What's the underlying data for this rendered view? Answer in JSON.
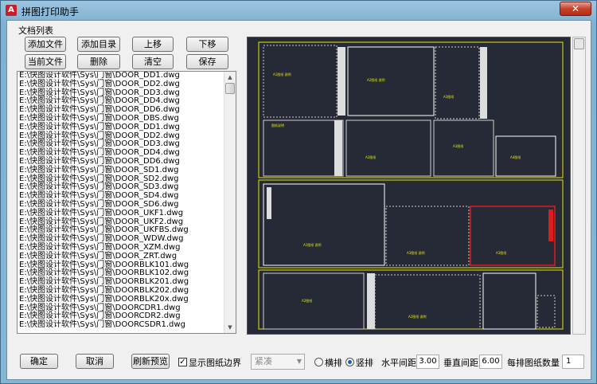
{
  "window": {
    "title": "拼图打印助手",
    "app_icon": "A",
    "close": "✕"
  },
  "file_group": {
    "label": "文档列表"
  },
  "toolbar": {
    "add_file": "添加文件",
    "add_dir": "添加目录",
    "move_up": "上移",
    "move_down": "下移",
    "current_file": "当前文件",
    "delete": "删除",
    "clear": "清空",
    "save": "保存"
  },
  "files": [
    "E:\\快图设计软件\\Sys\\门窗\\DOOR_DD1.dwg",
    "E:\\快图设计软件\\Sys\\门窗\\DOOR_DD2.dwg",
    "E:\\快图设计软件\\Sys\\门窗\\DOOR_DD3.dwg",
    "E:\\快图设计软件\\Sys\\门窗\\DOOR_DD4.dwg",
    "E:\\快图设计软件\\Sys\\门窗\\DOOR_DD6.dwg",
    "E:\\快图设计软件\\Sys\\门窗\\DOOR_DBS.dwg",
    "E:\\快图设计软件\\Sys\\门窗\\DOOR_DD1.dwg",
    "E:\\快图设计软件\\Sys\\门窗\\DOOR_DD2.dwg",
    "E:\\快图设计软件\\Sys\\门窗\\DOOR_DD3.dwg",
    "E:\\快图设计软件\\Sys\\门窗\\DOOR_DD4.dwg",
    "E:\\快图设计软件\\Sys\\门窗\\DOOR_DD6.dwg",
    "E:\\快图设计软件\\Sys\\门窗\\DOOR_SD1.dwg",
    "E:\\快图设计软件\\Sys\\门窗\\DOOR_SD2.dwg",
    "E:\\快图设计软件\\Sys\\门窗\\DOOR_SD3.dwg",
    "E:\\快图设计软件\\Sys\\门窗\\DOOR_SD4.dwg",
    "E:\\快图设计软件\\Sys\\门窗\\DOOR_SD6.dwg",
    "E:\\快图设计软件\\Sys\\门窗\\DOOR_UKF1.dwg",
    "E:\\快图设计软件\\Sys\\门窗\\DOOR_UKF2.dwg",
    "E:\\快图设计软件\\Sys\\门窗\\DOOR_UKFBS.dwg",
    "E:\\快图设计软件\\Sys\\门窗\\DOOR_WDW.dwg",
    "E:\\快图设计软件\\Sys\\门窗\\DOOR_XZM.dwg",
    "E:\\快图设计软件\\Sys\\门窗\\DOOR_ZRT.dwg",
    "E:\\快图设计软件\\Sys\\门窗\\DOORBLK101.dwg",
    "E:\\快图设计软件\\Sys\\门窗\\DOORBLK102.dwg",
    "E:\\快图设计软件\\Sys\\门窗\\DOORBLK201.dwg",
    "E:\\快图设计软件\\Sys\\门窗\\DOORBLK202.dwg",
    "E:\\快图设计软件\\Sys\\门窗\\DOORBLK20x.dwg",
    "E:\\快图设计软件\\Sys\\门窗\\DOORCDR1.dwg",
    "E:\\快图设计软件\\Sys\\门窗\\DOORCDR2.dwg",
    "E:\\快图设计软件\\Sys\\门窗\\DOORCSDR1.dwg"
  ],
  "bottom": {
    "ok": "确定",
    "cancel": "取消",
    "refresh": "刷新预览",
    "show_border": "显示图纸边界",
    "show_border_checked": true,
    "layout_combo": "紧凑",
    "horizontal": "横排",
    "vertical": "竖排",
    "orientation_selected": "vertical",
    "h_spacing_label": "水平间距",
    "h_spacing": "3.00",
    "v_spacing_label": "垂直间距",
    "v_spacing": "6.00",
    "per_row_label": "每排图纸数量",
    "per_row": "1"
  },
  "colors": {
    "preview_bg": "#252a36",
    "frame": "#e6e600",
    "sheet": "#ffffff",
    "highlight": "#e01b1b"
  }
}
